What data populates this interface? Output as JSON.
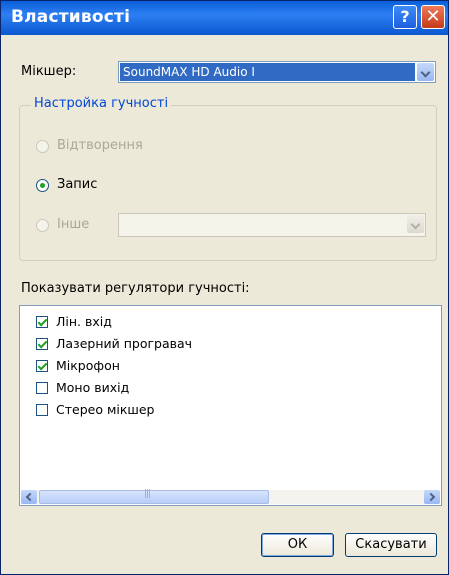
{
  "window": {
    "title": "Властивості",
    "help": "?",
    "close": "✕"
  },
  "mixer": {
    "label": "Мікшер:",
    "value": "SoundMAX HD Audio I"
  },
  "volume_group": {
    "title": "Настройка гучності",
    "options": [
      {
        "label": "Відтворення",
        "checked": false,
        "enabled": false
      },
      {
        "label": "Запис",
        "checked": true,
        "enabled": true
      },
      {
        "label": "Інше",
        "checked": false,
        "enabled": false
      }
    ]
  },
  "controls": {
    "label": "Показувати регулятори гучності:",
    "items": [
      {
        "label": "Лін. вхід",
        "checked": true
      },
      {
        "label": "Лазерний програвач",
        "checked": true
      },
      {
        "label": "Мікрофон",
        "checked": true
      },
      {
        "label": "Моно вихід",
        "checked": false
      },
      {
        "label": "Стерео мікшер",
        "checked": false
      }
    ]
  },
  "buttons": {
    "ok": "ОК",
    "cancel": "Скасувати"
  }
}
